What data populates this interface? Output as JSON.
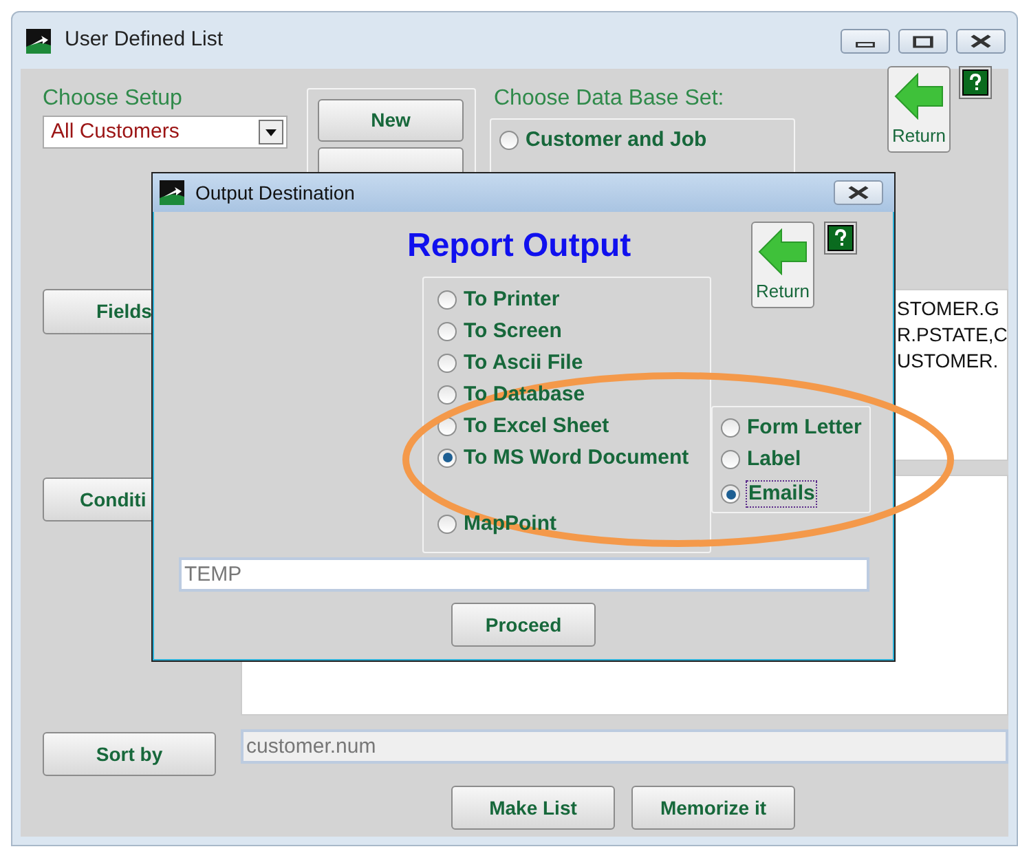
{
  "window": {
    "title": "User Defined List"
  },
  "setup": {
    "label": "Choose Setup",
    "value": "All Customers"
  },
  "setup_buttons": [
    {
      "label": "New"
    }
  ],
  "database_set": {
    "label": "Choose Data Base Set:",
    "options": [
      {
        "label": "Customer and Job",
        "selected": false
      }
    ]
  },
  "return_button": {
    "label": "Return"
  },
  "fields": {
    "button": {
      "label": "Fields"
    },
    "lines": [
      "STOMER.G",
      "R.PSTATE,C",
      "USTOMER."
    ]
  },
  "conditions": {
    "button": {
      "label": "Conditi"
    }
  },
  "sort": {
    "button": {
      "label": "Sort by"
    },
    "value": "customer.num"
  },
  "bottom_buttons": [
    {
      "label": "Make List"
    },
    {
      "label": "Memorize it"
    }
  ],
  "dialog": {
    "title": "Output Destination",
    "heading": "Report Output",
    "return_button": {
      "label": "Return"
    },
    "outputs": [
      {
        "label": "To Printer",
        "selected": false
      },
      {
        "label": "To Screen",
        "selected": false
      },
      {
        "label": "To Ascii File",
        "selected": false
      },
      {
        "label": "To Database",
        "selected": false
      },
      {
        "label": "To Excel Sheet",
        "selected": false
      },
      {
        "label": "To MS Word Document",
        "selected": true
      },
      {
        "label": "MapPoint",
        "selected": false
      }
    ],
    "word_options": [
      {
        "label": "Form Letter",
        "selected": false,
        "focused": false
      },
      {
        "label": "Label",
        "selected": false,
        "focused": false
      },
      {
        "label": "Emails",
        "selected": true,
        "focused": true
      }
    ],
    "file_name": "TEMP",
    "proceed_button": {
      "label": "Proceed"
    }
  },
  "annotation": {
    "kind": "ellipse",
    "color": "#f4994a"
  }
}
